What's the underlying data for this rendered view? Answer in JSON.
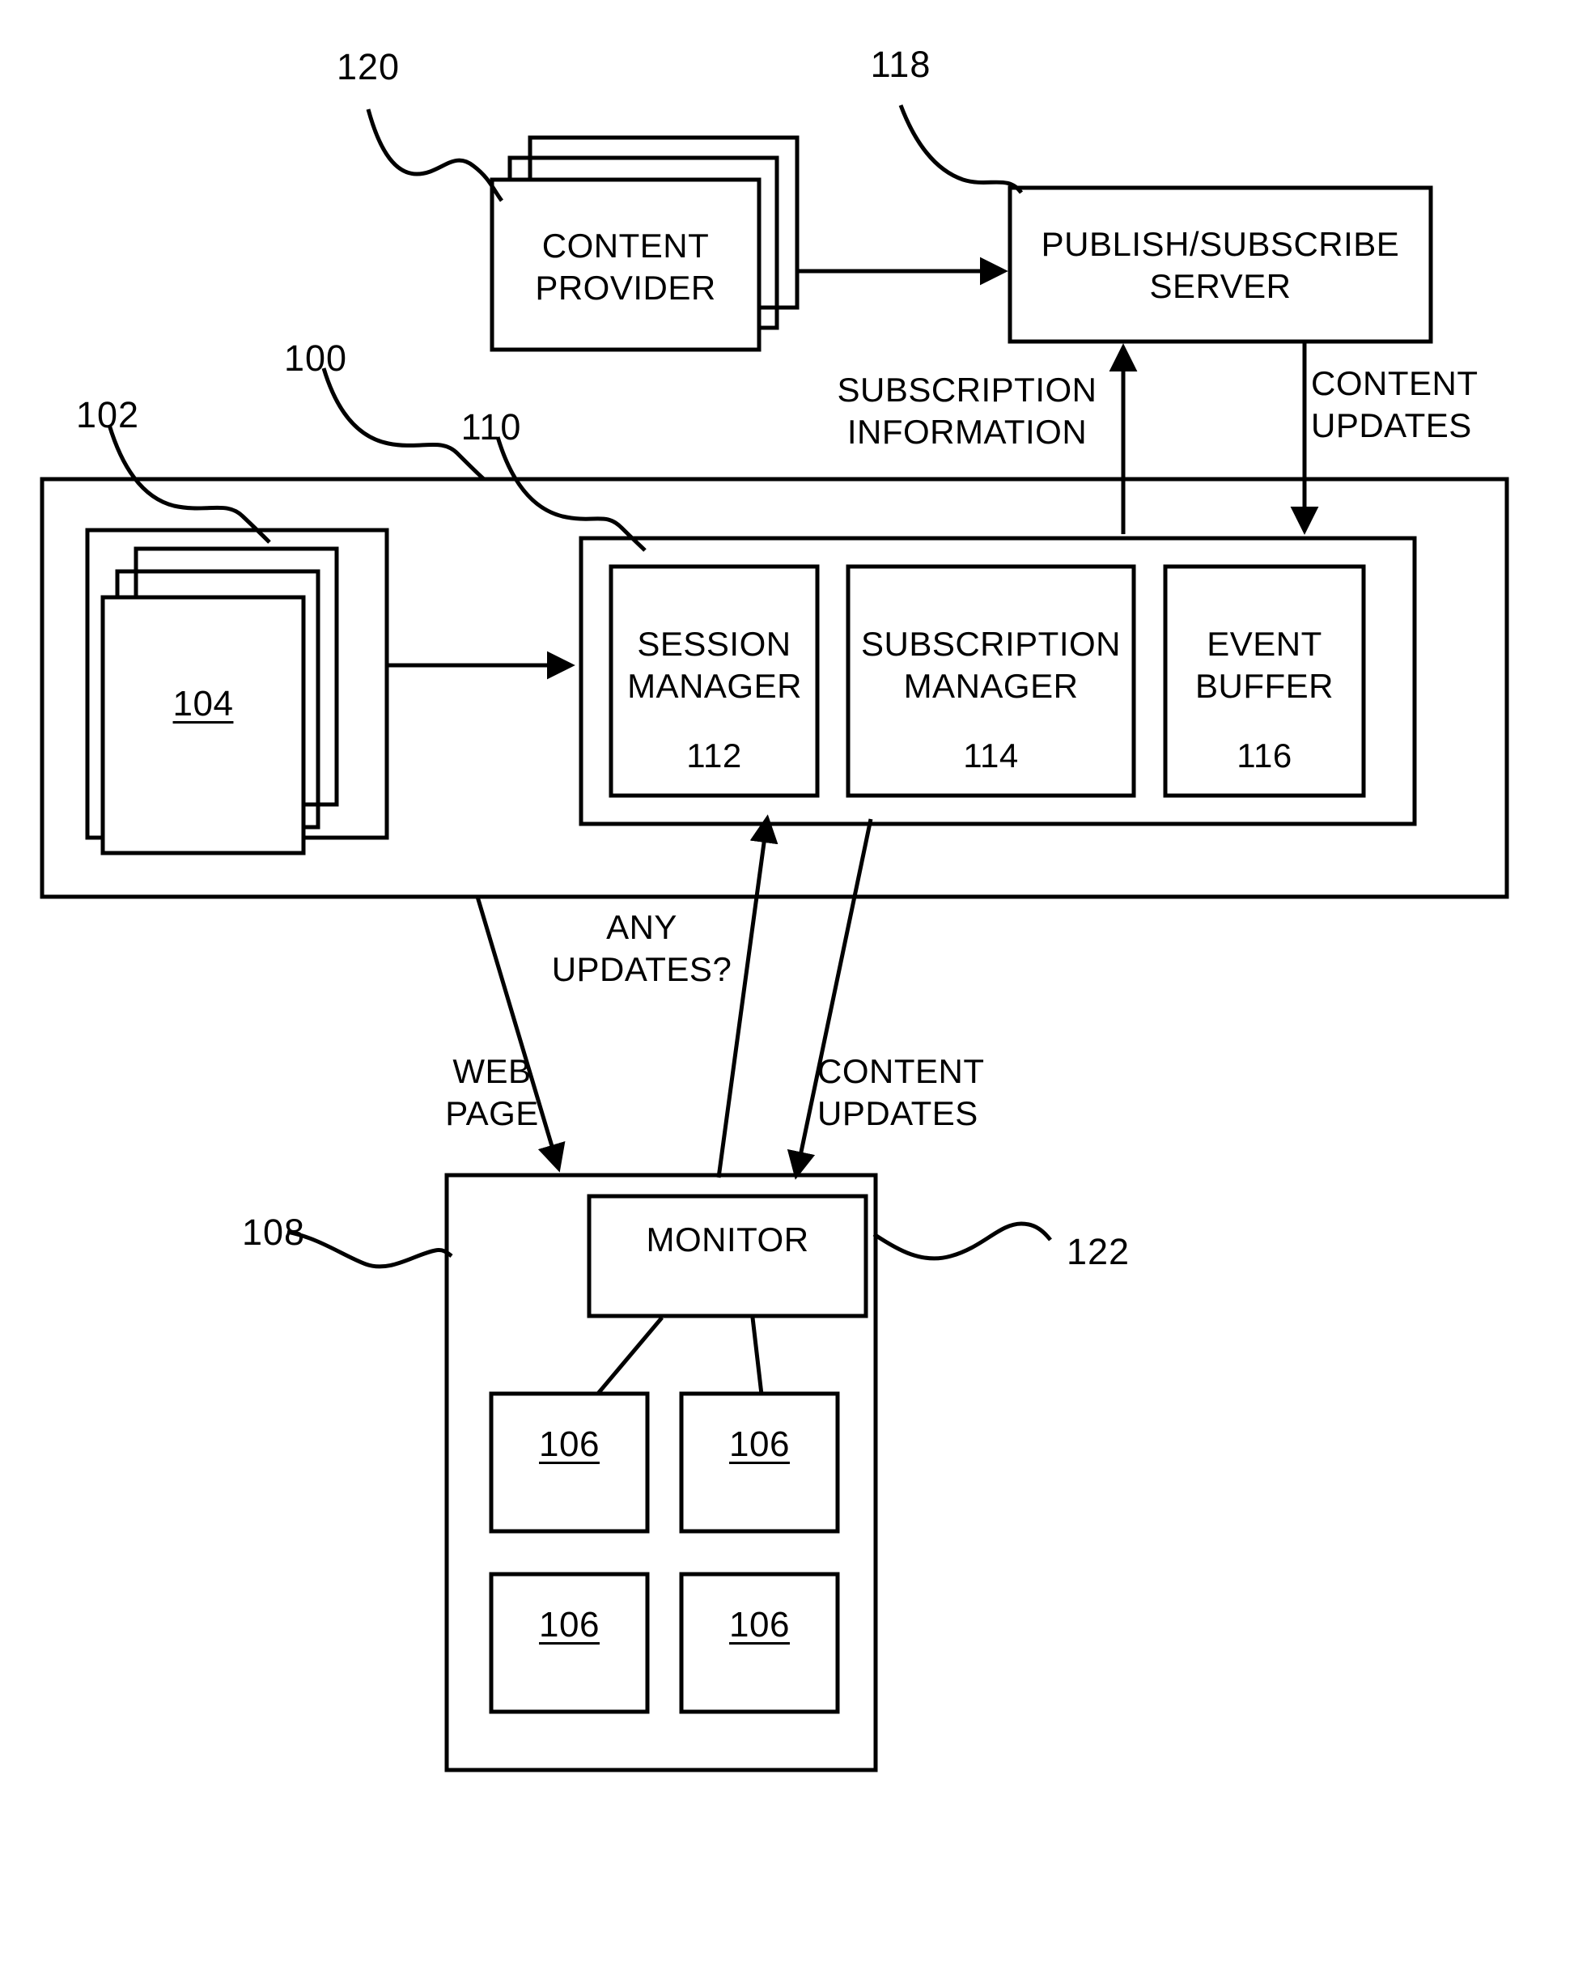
{
  "figure": {
    "type": "patent-block-diagram",
    "background": "#ffffff",
    "line_color": "#000000"
  },
  "reference_numerals": {
    "system_100": "100",
    "clients_102": "102",
    "client_104": "104",
    "server_110": "110",
    "browser_108": "108",
    "monitor_122": "122",
    "pubsub_118": "118",
    "content_provider_120": "120",
    "session_manager_112": "112",
    "subscription_manager_114": "114",
    "event_buffer_116": "116",
    "page_region_106_a": "106",
    "page_region_106_b": "106",
    "page_region_106_c": "106",
    "page_region_106_d": "106"
  },
  "blocks": {
    "content_provider": {
      "line1": "CONTENT",
      "line2": "PROVIDER"
    },
    "pubsub_server": {
      "line1": "PUBLISH/SUBSCRIBE",
      "line2": "SERVER"
    },
    "session_manager": {
      "line1": "SESSION",
      "line2": "MANAGER",
      "ref": "112"
    },
    "subscription_manager": {
      "line1": "SUBSCRIPTION",
      "line2": "MANAGER",
      "ref": "114"
    },
    "event_buffer": {
      "line1": "EVENT",
      "line2": "BUFFER",
      "ref": "116"
    },
    "monitor": {
      "label": "MONITOR"
    },
    "client_stack": {
      "ref": "104"
    },
    "page_regions": [
      "106",
      "106",
      "106",
      "106"
    ]
  },
  "flow_labels": {
    "subscription_information": {
      "line1": "SUBSCRIPTION",
      "line2": "INFORMATION"
    },
    "content_updates_top": {
      "line1": "CONTENT",
      "line2": "UPDATES"
    },
    "any_updates": {
      "line1": "ANY",
      "line2": "UPDATES?"
    },
    "web_page": {
      "line1": "WEB",
      "line2": "PAGE"
    },
    "content_updates_bottom": {
      "line1": "CONTENT",
      "line2": "UPDATES"
    }
  }
}
